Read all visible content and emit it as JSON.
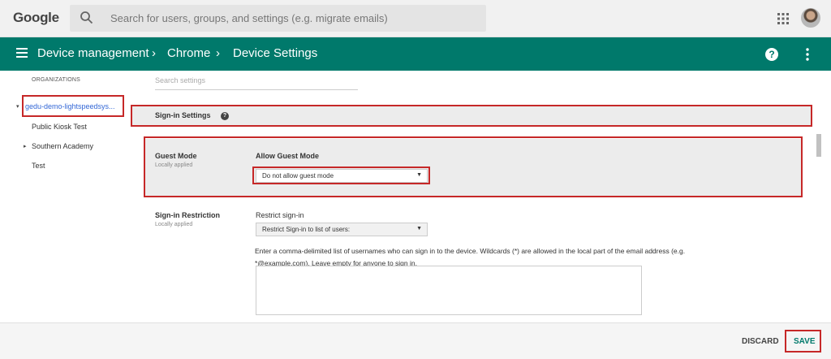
{
  "topbar": {
    "logo": "Google",
    "search_placeholder": "Search for users, groups, and settings (e.g. migrate emails)",
    "icons": [
      "search-icon",
      "apps-grid-icon",
      "avatar"
    ]
  },
  "header": {
    "breadcrumb": [
      "Device management",
      "Chrome",
      "Device Settings"
    ],
    "separator": "›",
    "help": "?",
    "icons": [
      "menu-icon",
      "help-icon",
      "more-vert-icon"
    ],
    "color": "#00796b"
  },
  "sidebar": {
    "title": "ORGANIZATIONS",
    "items": [
      {
        "label": "gedu-demo-lightspeedsys...",
        "selected": true
      },
      {
        "label": "Public Kiosk Test"
      },
      {
        "label": "Southern Academy"
      },
      {
        "label": "Test"
      }
    ]
  },
  "settings": {
    "search_placeholder": "Search settings",
    "section_title": "Sign-in Settings",
    "guest_mode": {
      "label": "Guest Mode",
      "sublabel": "Locally applied",
      "field_label": "Allow Guest Mode",
      "value": "Do not allow guest mode"
    },
    "signin_restriction": {
      "label": "Sign-in Restriction",
      "sublabel": "Locally applied",
      "field_label": "Restrict sign-in",
      "value": "Restrict Sign-in to list of users:",
      "description_line1": "Enter a comma-delimited list of usernames who can sign in to the device. Wildcards (*) are allowed in the local part of the email address (e.g.",
      "description_line2": "*@example.com). Leave empty for anyone to sign in.",
      "textarea_value": ""
    }
  },
  "footer": {
    "discard": "DISCARD",
    "save": "SAVE"
  },
  "colors": {
    "accent": "#00796b",
    "highlight": "#c62828",
    "selected_org": "#3367d6"
  }
}
